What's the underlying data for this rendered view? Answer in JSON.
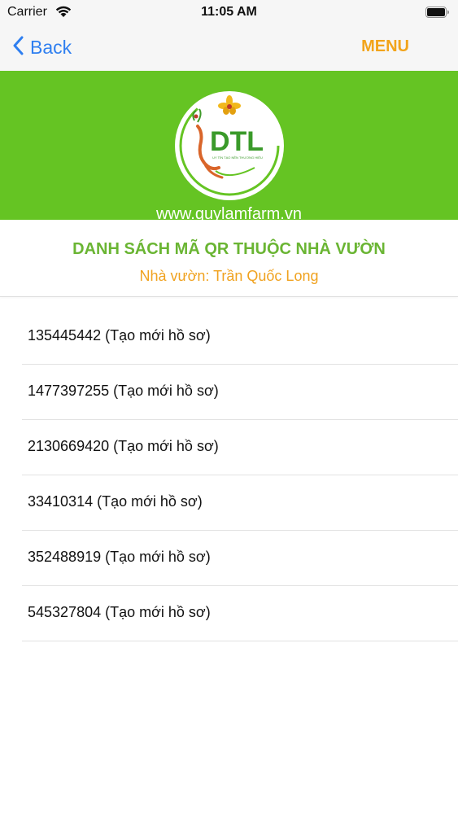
{
  "status_bar": {
    "carrier": "Carrier",
    "time": "11:05 AM"
  },
  "nav": {
    "back_label": "Back",
    "menu_label": "MENU"
  },
  "banner": {
    "background": "#65c423",
    "logo_text": "DTL",
    "logo_tagline": "UY TÍN TẠO NÊN THƯƠNG HIỆU",
    "website": "www.quylamfarm.vn"
  },
  "heading": {
    "title": "DANH SÁCH MÃ QR THUỘC NHÀ VƯỜN",
    "subtitle": "Nhà vườn: Trần Quốc Long"
  },
  "qr_items": [
    "135445442 (Tạo mới hồ sơ)",
    "1477397255 (Tạo mới hồ sơ)",
    "2130669420 (Tạo mới hồ sơ)",
    "33410314 (Tạo mới hồ sơ)",
    "352488919 (Tạo mới hồ sơ)",
    "545327804 (Tạo mới hồ sơ)"
  ],
  "colors": {
    "accent_blue": "#2f7ff0",
    "menu_orange": "#f2a41b",
    "heading_green": "#6ab533",
    "subtitle_orange": "#f0a21f"
  }
}
